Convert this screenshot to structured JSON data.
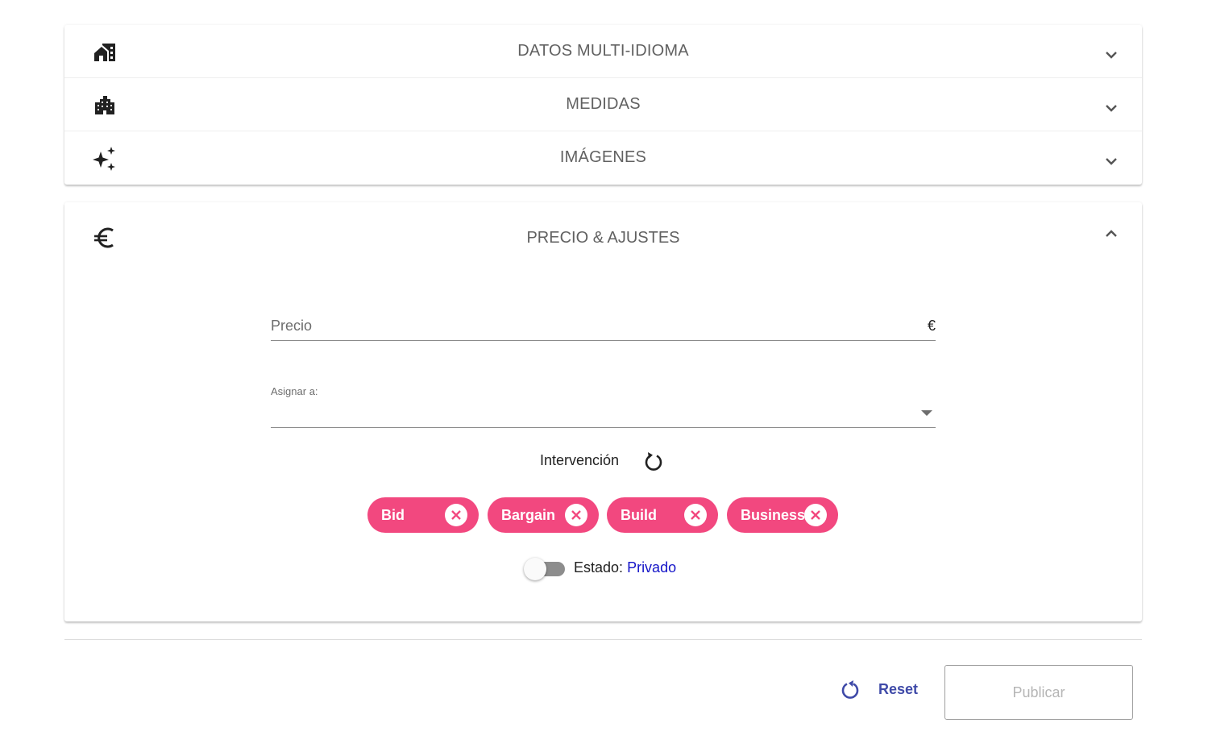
{
  "sections": [
    {
      "title": "DATOS MULTI-IDIOMA",
      "icon": "house-building-icon",
      "expanded": false
    },
    {
      "title": "MEDIDAS",
      "icon": "city-buildings-icon",
      "expanded": false
    },
    {
      "title": "IMÁGENES",
      "icon": "sparkles-icon",
      "expanded": false
    }
  ],
  "price_section": {
    "title": "PRECIO & AJUSTES",
    "icon": "euro-icon",
    "expanded": true,
    "price_label": "Precio",
    "price_unit": "€",
    "assign_label": "Asignar a:",
    "intervention_label": "Intervención",
    "chips": [
      "Bid",
      "Bargain",
      "Build",
      "Business"
    ],
    "chip_color": "#f2487f",
    "status_label": "Estado:",
    "status_value": "Privado",
    "status_on": false
  },
  "footer": {
    "reset_label": "Reset",
    "publish_label": "Publicar"
  }
}
